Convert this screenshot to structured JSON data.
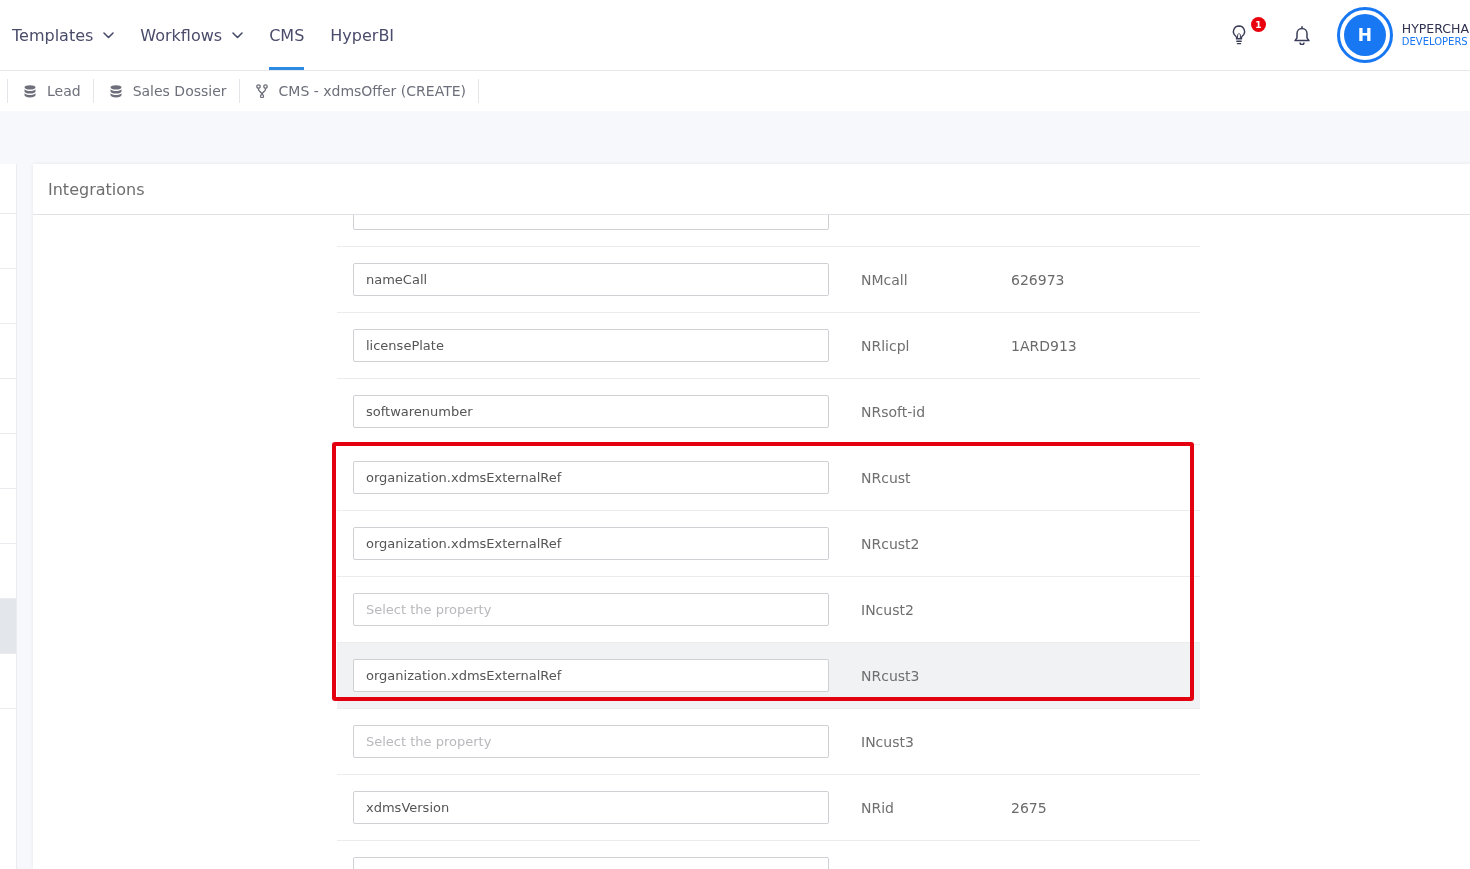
{
  "top_nav": {
    "items": [
      {
        "label": "Templates",
        "dropdown": true,
        "selected": false
      },
      {
        "label": "Workflows",
        "dropdown": true,
        "selected": false
      },
      {
        "label": "CMS",
        "dropdown": false,
        "selected": true
      },
      {
        "label": "HyperBI",
        "dropdown": false,
        "selected": false
      }
    ],
    "notification_badge": "1",
    "user": {
      "initial": "H",
      "name": "HYPERCHA",
      "role": "DEVELOPERS"
    }
  },
  "open_tabs": [
    {
      "label": "Lead",
      "kind": "database"
    },
    {
      "label": "Sales Dossier",
      "kind": "database"
    },
    {
      "label": "CMS - xdmsOffer (CREATE)",
      "kind": "workflow"
    }
  ],
  "side_panel": {
    "rows": [
      {
        "selected": false
      },
      {
        "selected": false
      },
      {
        "selected": false
      },
      {
        "selected": false
      },
      {
        "selected": false
      },
      {
        "selected": false
      },
      {
        "selected": false
      },
      {
        "selected": true
      },
      {
        "selected": false
      }
    ]
  },
  "panel": {
    "title": "Integrations",
    "rows": [
      {
        "highlighted": false,
        "hovered": false
      },
      {
        "value": "nameCall",
        "code": "NMcall",
        "sample": "626973",
        "highlighted": false,
        "hovered": false
      },
      {
        "value": "licensePlate",
        "code": "NRlicpl",
        "sample": "1ARD913",
        "highlighted": false,
        "hovered": false
      },
      {
        "value": "softwarenumber",
        "code": "NRsoft-id",
        "highlighted": false,
        "hovered": false
      },
      {
        "value": "organization.xdmsExternalRef",
        "code": "NRcust",
        "highlighted": true,
        "hovered": false
      },
      {
        "value": "organization.xdmsExternalRef",
        "code": "NRcust2",
        "highlighted": true,
        "hovered": false
      },
      {
        "placeholder": "Select the property",
        "code": "INcust2",
        "highlighted": true,
        "hovered": false
      },
      {
        "value": "organization.xdmsExternalRef",
        "code": "NRcust3",
        "highlighted": true,
        "hovered": true
      },
      {
        "placeholder": "Select the property",
        "code": "INcust3",
        "highlighted": false,
        "hovered": false
      },
      {
        "value": "xdmsVersion",
        "code": "NRid",
        "sample": "2675",
        "highlighted": false,
        "hovered": false
      },
      {
        "highlighted": false,
        "hovered": false
      }
    ]
  }
}
